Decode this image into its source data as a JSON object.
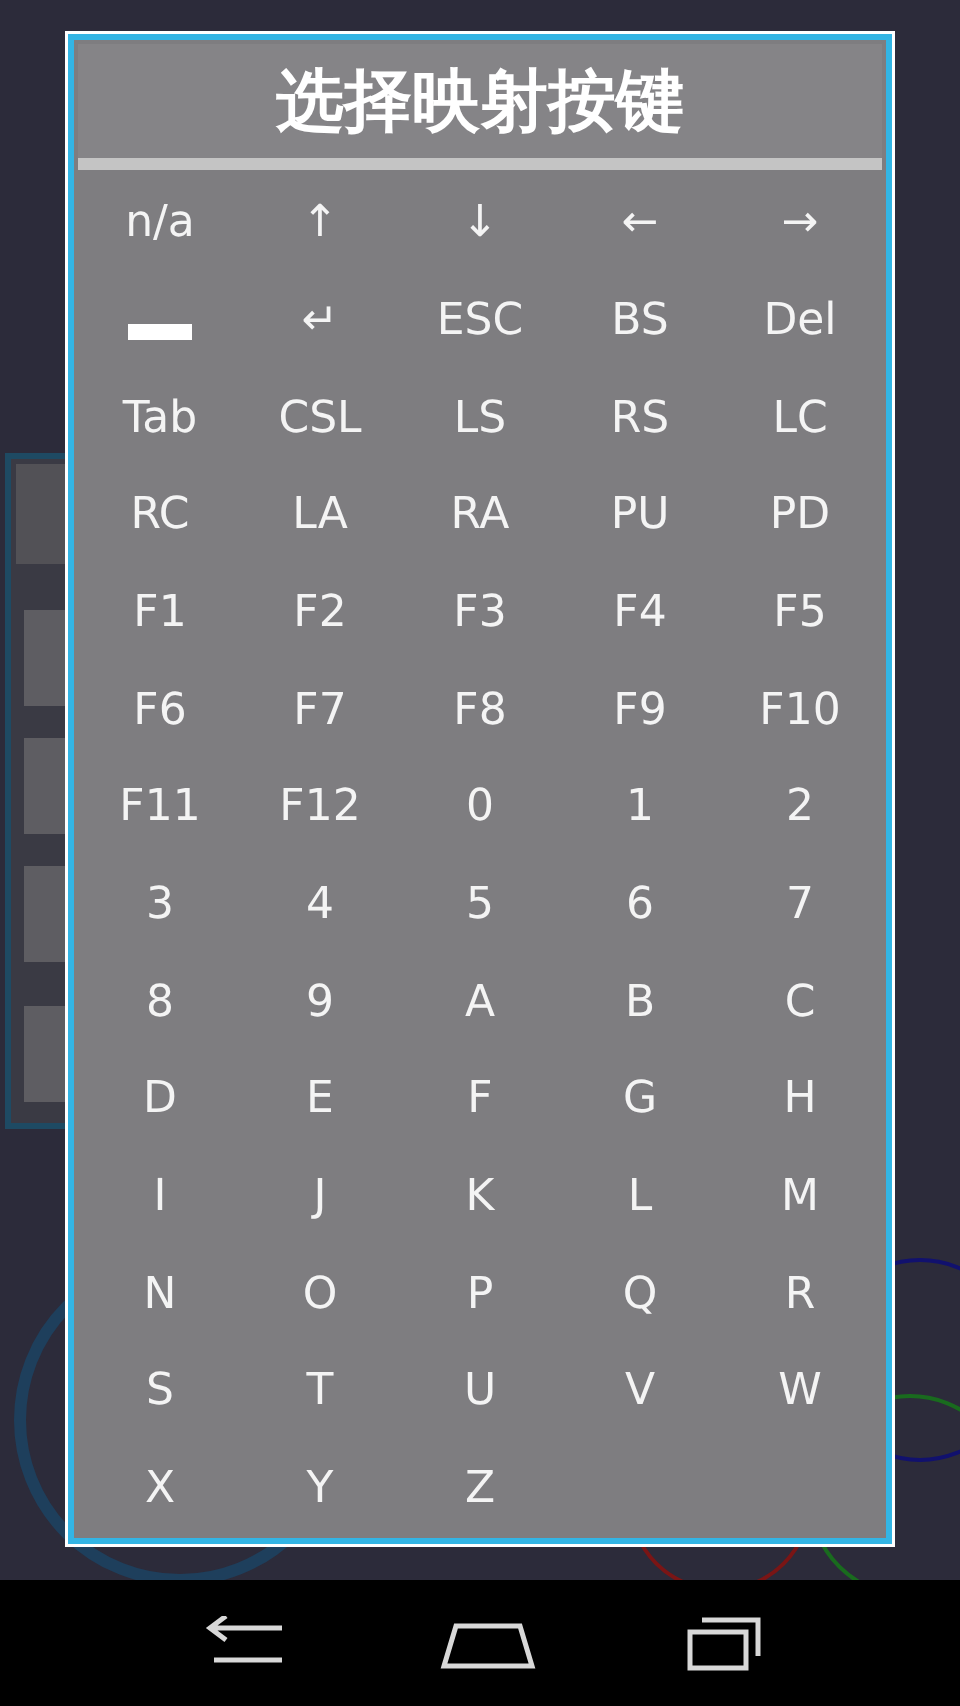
{
  "dialog": {
    "title": "选择映射按键",
    "keys": [
      {
        "kind": "text",
        "label": "n/a"
      },
      {
        "kind": "text",
        "label": "↑"
      },
      {
        "kind": "text",
        "label": "↓"
      },
      {
        "kind": "text",
        "label": "←"
      },
      {
        "kind": "text",
        "label": "→"
      },
      {
        "kind": "space"
      },
      {
        "kind": "text",
        "label": "↵"
      },
      {
        "kind": "text",
        "label": "ESC"
      },
      {
        "kind": "text",
        "label": "BS"
      },
      {
        "kind": "text",
        "label": "Del"
      },
      {
        "kind": "text",
        "label": "Tab"
      },
      {
        "kind": "text",
        "label": "CSL"
      },
      {
        "kind": "text",
        "label": "LS"
      },
      {
        "kind": "text",
        "label": "RS"
      },
      {
        "kind": "text",
        "label": "LC"
      },
      {
        "kind": "text",
        "label": "RC"
      },
      {
        "kind": "text",
        "label": "LA"
      },
      {
        "kind": "text",
        "label": "RA"
      },
      {
        "kind": "text",
        "label": "PU"
      },
      {
        "kind": "text",
        "label": "PD"
      },
      {
        "kind": "text",
        "label": "F1"
      },
      {
        "kind": "text",
        "label": "F2"
      },
      {
        "kind": "text",
        "label": "F3"
      },
      {
        "kind": "text",
        "label": "F4"
      },
      {
        "kind": "text",
        "label": "F5"
      },
      {
        "kind": "text",
        "label": "F6"
      },
      {
        "kind": "text",
        "label": "F7"
      },
      {
        "kind": "text",
        "label": "F8"
      },
      {
        "kind": "text",
        "label": "F9"
      },
      {
        "kind": "text",
        "label": "F10"
      },
      {
        "kind": "text",
        "label": "F11"
      },
      {
        "kind": "text",
        "label": "F12"
      },
      {
        "kind": "text",
        "label": "0"
      },
      {
        "kind": "text",
        "label": "1"
      },
      {
        "kind": "text",
        "label": "2"
      },
      {
        "kind": "text",
        "label": "3"
      },
      {
        "kind": "text",
        "label": "4"
      },
      {
        "kind": "text",
        "label": "5"
      },
      {
        "kind": "text",
        "label": "6"
      },
      {
        "kind": "text",
        "label": "7"
      },
      {
        "kind": "text",
        "label": "8"
      },
      {
        "kind": "text",
        "label": "9"
      },
      {
        "kind": "text",
        "label": "A"
      },
      {
        "kind": "text",
        "label": "B"
      },
      {
        "kind": "text",
        "label": "C"
      },
      {
        "kind": "text",
        "label": "D"
      },
      {
        "kind": "text",
        "label": "E"
      },
      {
        "kind": "text",
        "label": "F"
      },
      {
        "kind": "text",
        "label": "G"
      },
      {
        "kind": "text",
        "label": "H"
      },
      {
        "kind": "text",
        "label": "I"
      },
      {
        "kind": "text",
        "label": "J"
      },
      {
        "kind": "text",
        "label": "K"
      },
      {
        "kind": "text",
        "label": "L"
      },
      {
        "kind": "text",
        "label": "M"
      },
      {
        "kind": "text",
        "label": "N"
      },
      {
        "kind": "text",
        "label": "O"
      },
      {
        "kind": "text",
        "label": "P"
      },
      {
        "kind": "text",
        "label": "Q"
      },
      {
        "kind": "text",
        "label": "R"
      },
      {
        "kind": "text",
        "label": "S"
      },
      {
        "kind": "text",
        "label": "T"
      },
      {
        "kind": "text",
        "label": "U"
      },
      {
        "kind": "text",
        "label": "V"
      },
      {
        "kind": "text",
        "label": "W"
      },
      {
        "kind": "text",
        "label": "X"
      },
      {
        "kind": "text",
        "label": "Y"
      },
      {
        "kind": "text",
        "label": "Z"
      }
    ]
  },
  "nav_bar": {
    "buttons": [
      {
        "kind": "back"
      },
      {
        "kind": "home"
      },
      {
        "kind": "recents"
      }
    ]
  }
}
